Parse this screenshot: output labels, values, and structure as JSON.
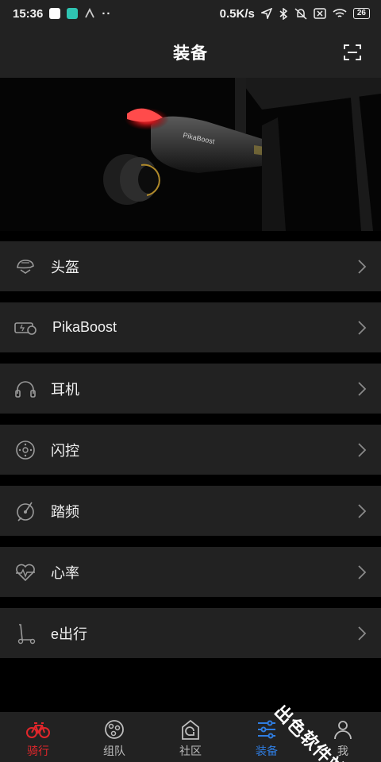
{
  "status_bar": {
    "time": "15:36",
    "more": "··",
    "network_speed": "0.5K/s",
    "battery": "26"
  },
  "header": {
    "title": "装备",
    "scan_icon": "scan-frame-icon"
  },
  "hero": {
    "product_text": "PikaBoost"
  },
  "equipment_list": [
    {
      "label": "头盔",
      "icon": "helmet-icon"
    },
    {
      "label": "PikaBoost",
      "icon": "battery-boost-icon"
    },
    {
      "label": "耳机",
      "icon": "headphones-icon"
    },
    {
      "label": "闪控",
      "icon": "remote-control-icon"
    },
    {
      "label": "踏频",
      "icon": "cadence-sensor-icon"
    },
    {
      "label": "心率",
      "icon": "heart-rate-icon"
    },
    {
      "label": "e出行",
      "icon": "scooter-icon"
    }
  ],
  "tab_bar": [
    {
      "label": "骑行",
      "icon": "bicycle-icon",
      "state": "active-red"
    },
    {
      "label": "组队",
      "icon": "team-icon",
      "state": "normal"
    },
    {
      "label": "社区",
      "icon": "community-icon",
      "state": "normal"
    },
    {
      "label": "装备",
      "icon": "equipment-sliders-icon",
      "state": "active-blue"
    },
    {
      "label": "我",
      "icon": "profile-icon",
      "state": "normal"
    }
  ],
  "watermark": "出色软件站",
  "colors": {
    "background": "#000000",
    "surface": "#222222",
    "accent_red": "#e0262b",
    "accent_blue": "#2f7de1",
    "icon_gray": "#9a9a9a"
  }
}
